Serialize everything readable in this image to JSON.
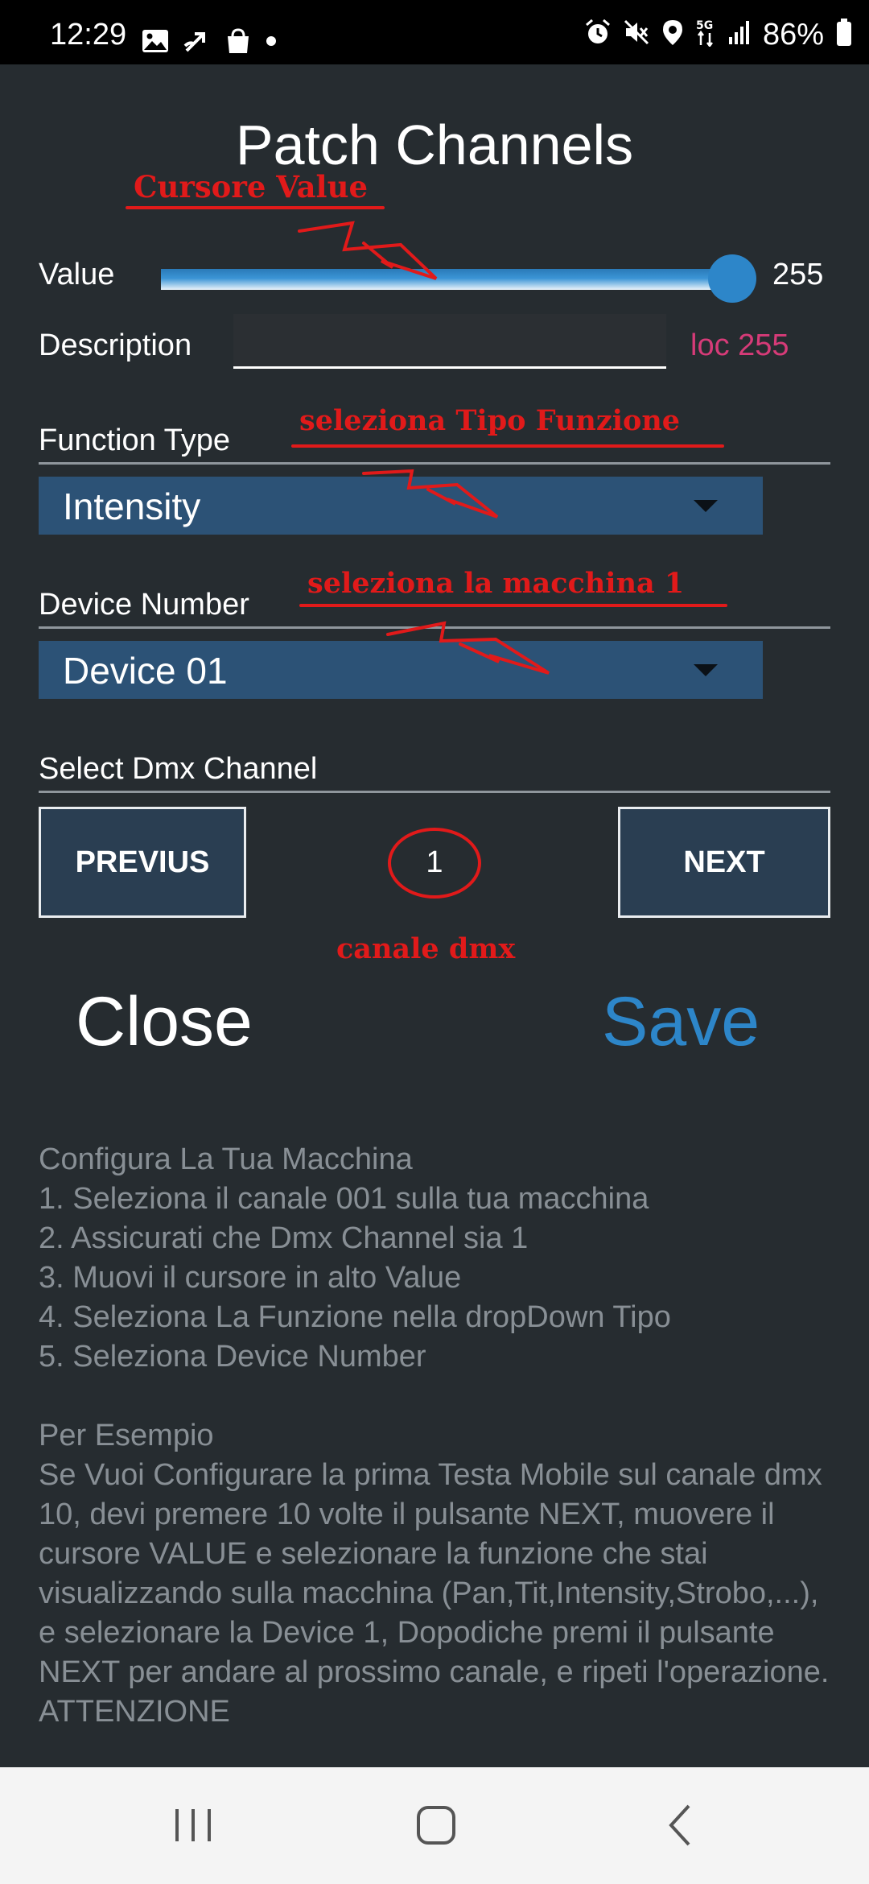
{
  "status_bar": {
    "time": "12:29",
    "battery": "86%"
  },
  "screen": {
    "title": "Patch Channels",
    "value_label": "Value",
    "value": "255",
    "slider_level": 1.0,
    "description_label": "Description",
    "description_value": "",
    "loc_text": "loc 255",
    "function_type_label": "Function Type",
    "function_type_selected": "Intensity",
    "device_number_label": "Device Number",
    "device_selected": "Device 01",
    "dmx_channel_label": "Select Dmx Channel",
    "previous_label": "PREVIUS",
    "next_label": "NEXT",
    "channel_number": "1",
    "close_label": "Close",
    "save_label": "Save",
    "instructions": "Configura La Tua Macchina\n1. Seleziona il canale 001 sulla tua macchina\n2. Assicurati che Dmx Channel sia 1\n3. Muovi il cursore in alto Value\n4. Seleziona La Funzione nella dropDown Tipo\n5. Seleziona Device Number\n\nPer Esempio\nSe Vuoi Configurare la prima Testa Mobile sul canale dmx 10, devi premere 10 volte il pulsante NEXT, muovere il cursore VALUE e selezionare la funzione che stai visualizzando sulla macchina (Pan,Tit,Intensity,Strobo,...), e selezionare la Device 1, Dopodiche premi il pulsante NEXT per andare al prossimo canale, e ripeti l'operazione.\nATTENZIONE"
  },
  "annotations": {
    "cursor_value": "Cursore Value",
    "function_type": "seleziona Tipo Funzione",
    "device": "seleziona la macchina 1",
    "dmx_channel": "canale dmx"
  },
  "colors": {
    "background": "#262c30",
    "accent_blue": "#2d86c9",
    "dropdown": "#2c5276",
    "loc_pink": "#d63b78",
    "annotation_red": "#e11a1a"
  },
  "icons": {
    "status_left": [
      "gallery-icon",
      "missed-call-icon",
      "shopping-bag-icon",
      "dot-icon"
    ],
    "status_right": [
      "alarm-icon",
      "mute-icon",
      "location-icon",
      "5g-icon",
      "signal-icon",
      "battery-icon"
    ],
    "nav": [
      "recent-apps-icon",
      "home-icon",
      "back-icon"
    ]
  }
}
